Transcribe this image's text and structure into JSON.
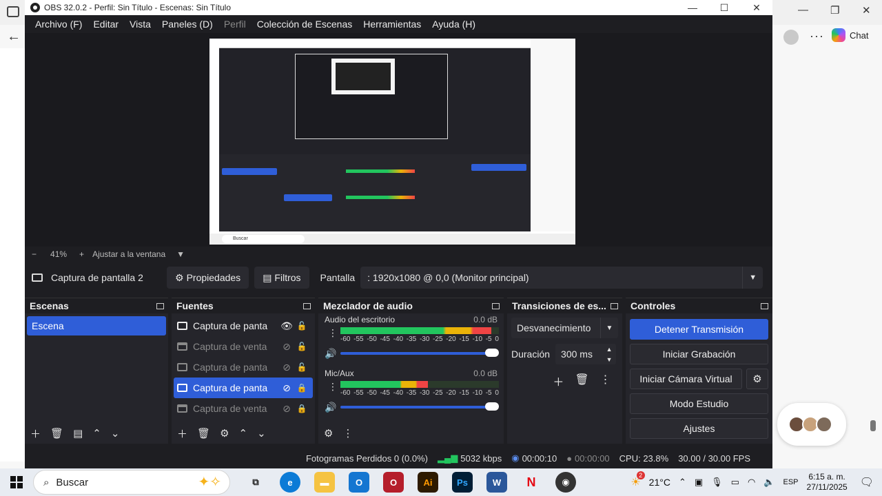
{
  "window": {
    "title": "OBS 32.0.2 - Perfil: Sin Título - Escenas: Sin Título",
    "minimize": "—",
    "maximize": "☐",
    "close": "✕"
  },
  "menu": [
    "Archivo (F)",
    "Editar",
    "Vista",
    "Paneles (D)",
    "Perfil",
    "Colección de Escenas",
    "Herramientas",
    "Ayuda (H)"
  ],
  "zoom": {
    "minus": "−",
    "value": "41%",
    "plus": "+",
    "fit": "Ajustar a la ventana",
    "caret": "▼"
  },
  "source_bar": {
    "name": "Captura de pantalla 2",
    "properties": "Propiedades",
    "filters": "Filtros",
    "display_label": "Pantalla",
    "display_value": ": 1920x1080 @ 0,0 (Monitor principal)"
  },
  "scenes": {
    "title": "Escenas",
    "items": [
      "Escena"
    ]
  },
  "sources": {
    "title": "Fuentes",
    "items": [
      {
        "label": "Captura de panta",
        "type": "monitor",
        "visible": "👁",
        "lock": "🔓"
      },
      {
        "label": "Captura de venta",
        "type": "window",
        "visible": "⊘",
        "lock": "🔓"
      },
      {
        "label": "Captura de panta",
        "type": "monitor",
        "visible": "⊘",
        "lock": "🔓"
      },
      {
        "label": "Captura de panta",
        "type": "monitor",
        "visible": "⊘",
        "lock": "🔒"
      },
      {
        "label": "Captura de venta",
        "type": "window",
        "visible": "⊘",
        "lock": "🔒"
      }
    ]
  },
  "mixer": {
    "title": "Mezclador de audio",
    "tracks": [
      {
        "name": "Audio del escritorio",
        "db": "0.0 dB",
        "level": 0.95
      },
      {
        "name": "Mic/Aux",
        "db": "0.0 dB",
        "level": 0.55
      }
    ],
    "ticks": [
      "-60",
      "-55",
      "-50",
      "-45",
      "-40",
      "-35",
      "-30",
      "-25",
      "-20",
      "-15",
      "-10",
      "-5",
      "0"
    ]
  },
  "transitions": {
    "title": "Transiciones de es...",
    "selected": "Desvanecimiento",
    "duration_label": "Duración",
    "duration_value": "300 ms"
  },
  "controls": {
    "title": "Controles",
    "stop_stream": "Detener Transmisión",
    "start_record": "Iniciar Grabación",
    "virtual_cam": "Iniciar Cámara Virtual",
    "studio_mode": "Modo Estudio",
    "settings": "Ajustes"
  },
  "status": {
    "dropped": "Fotogramas Perdidos 0 (0.0%)",
    "bitrate": "5032 kbps",
    "stream_time": "00:00:10",
    "record_time": "00:00:00",
    "cpu": "CPU: 23.8%",
    "fps": "30.00 / 30.00 FPS"
  },
  "browser": {
    "chat": "Chat"
  },
  "taskbar": {
    "search_placeholder": "Buscar",
    "weather": "21°C",
    "weather_badge": "2",
    "lang": "ESP",
    "time": "6:15 a. m.",
    "date": "27/11/2025"
  },
  "colors": {
    "accent": "#2f5ed8",
    "panel_bg": "#25252b",
    "window_bg": "#1e1e22"
  }
}
